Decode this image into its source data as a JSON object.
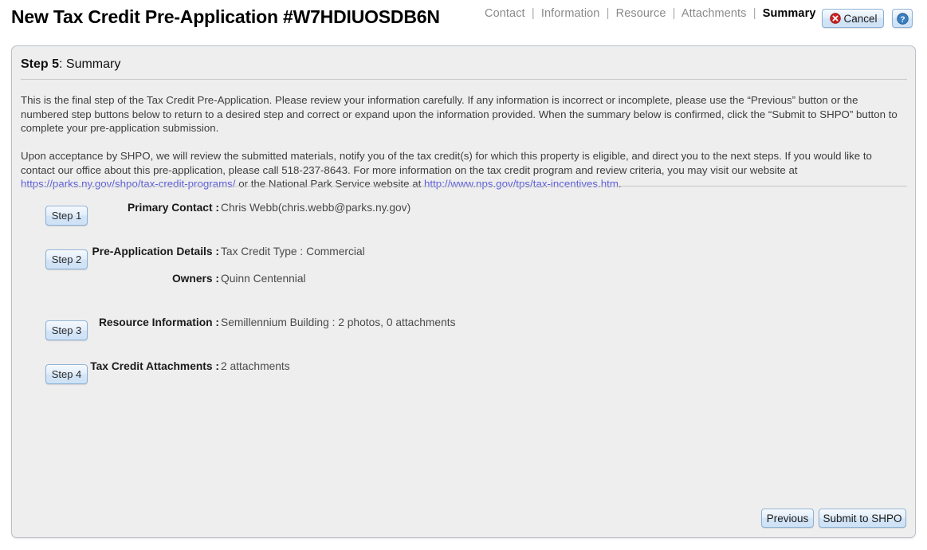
{
  "header": {
    "title": "New Tax Credit Pre-Application #W7HDIUOSDB6N",
    "nav": [
      {
        "label": "Contact",
        "current": false
      },
      {
        "label": "Information",
        "current": false
      },
      {
        "label": "Resource",
        "current": false
      },
      {
        "label": "Attachments",
        "current": false
      },
      {
        "label": "Summary",
        "current": true
      }
    ],
    "nav_separator": "|",
    "cancel_label": "Cancel",
    "cancel_icon": "close-circle-icon",
    "help_icon": "question-circle-icon"
  },
  "panel": {
    "heading_bold": "Step 5",
    "heading_rest": ": Summary",
    "paragraph_1": "This is the final step of the Tax Credit Pre-Application. Please review your information carefully. If any information is incorrect or incomplete, please use the “Previous” button or the numbered step buttons below to return to a desired step and correct or expand upon the information provided. When the summary below is confirmed, click the “Submit to SHPO” button to complete your pre-application submission.",
    "paragraph_2_part1": "Upon acceptance by SHPO, we will review the submitted materials, notify you of the tax credit(s) for which this property is eligible, and direct you to the next steps. If you would like to contact our office about this pre-application, please call 518-237-8643. For more information on the tax credit program and review criteria, you may visit our website at ",
    "link_1": "https://parks.ny.gov/shpo/tax-credit-programs/",
    "paragraph_2_part2": " or the National Park Service website at ",
    "link_2": "http://www.nps.gov/tps/tax-incentives.htm",
    "paragraph_2_part3": "."
  },
  "summary": [
    {
      "step_label": "Step 1",
      "rows": [
        {
          "label": "Primary Contact :",
          "value": "Chris Webb(chris.webb@parks.ny.gov)"
        }
      ]
    },
    {
      "step_label": "Step 2",
      "rows": [
        {
          "label": "Pre-Application Details :",
          "value": "Tax Credit Type : Commercial"
        },
        {
          "label": "Owners :",
          "value": "Quinn Centennial"
        }
      ]
    },
    {
      "step_label": "Step 3",
      "rows": [
        {
          "label": "Resource Information :",
          "value": "Semillennium Building : 2 photos, 0 attachments"
        }
      ]
    },
    {
      "step_label": "Step 4",
      "rows": [
        {
          "label": "Tax Credit Attachments :",
          "value": "2 attachments"
        }
      ]
    }
  ],
  "footer": {
    "previous_label": "Previous",
    "submit_label": "Submit to SHPO"
  },
  "colors": {
    "link": "#5b5bdd",
    "panel_bg": "#eeeeee",
    "panel_border": "#b9bfcb",
    "button_border": "#8ab0d6",
    "cancel_icon_red": "#cc2222",
    "help_icon_blue": "#3a7fc1"
  }
}
